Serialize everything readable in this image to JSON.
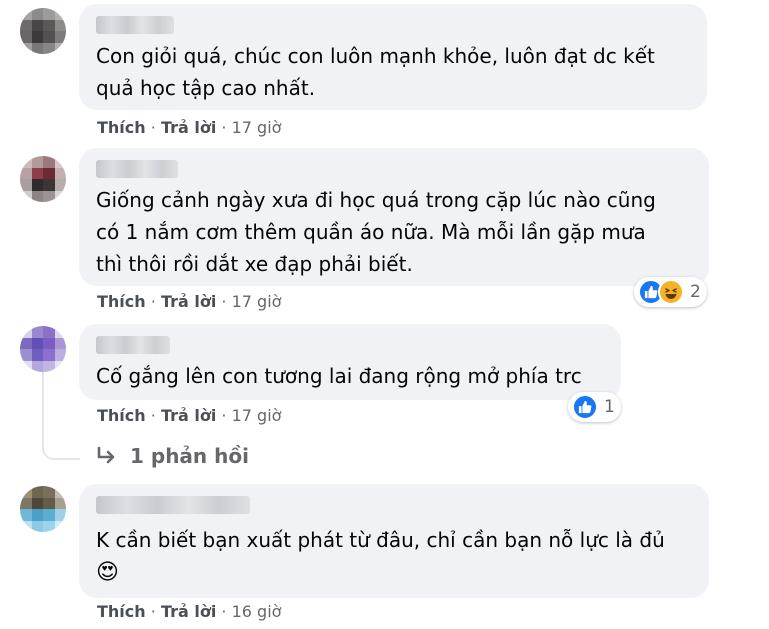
{
  "comments": [
    {
      "text_lines": [
        "Con giỏi quá, chúc con luôn mạnh khỏe, luôn đạt dc kết",
        "quả học tập cao nhất."
      ],
      "like": "Thích",
      "reply": "Trả lời",
      "time": "17 giờ"
    },
    {
      "text_lines": [
        "Giống cảnh ngày xưa đi học quá trong cặp lúc nào cũng",
        "có 1 nắm cơm thêm quần áo nữa. Mà mỗi lần gặp mưa",
        "thì thôi rồi dắt xe đạp phải biết."
      ],
      "like": "Thích",
      "reply": "Trả lời",
      "time": "17 giờ",
      "reactions": {
        "icons": [
          "like-icon",
          "haha-icon"
        ],
        "count": "2"
      }
    },
    {
      "text_lines": [
        "Cố gắng lên con tương lai đang rộng mở phía trc"
      ],
      "like": "Thích",
      "reply": "Trả lời",
      "time": "17 giờ",
      "reactions": {
        "icons": [
          "like-icon"
        ],
        "count": "1"
      },
      "replies_label": "1 phản hồi"
    },
    {
      "text_lines": [
        "K cần biết bạn xuất phát từ đâu, chỉ cần bạn nỗ lực là đủ"
      ],
      "emoji": "😍",
      "like": "Thích",
      "reply": "Trả lời",
      "time": "16 giờ"
    }
  ],
  "separator": "·",
  "colors": {
    "bubble": "#f0f2f5",
    "action_text": "#65676b",
    "like_blue": "#1877f2",
    "haha_yellow": "#f7b125"
  }
}
